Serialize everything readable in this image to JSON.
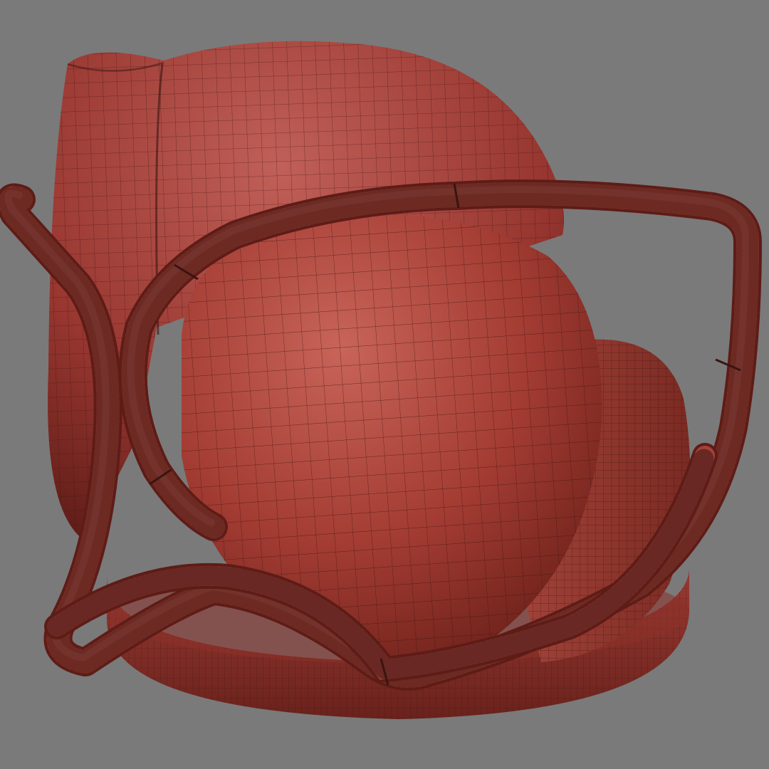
{
  "scene": {
    "subject": "chair-wireframe-render",
    "colors": {
      "background": "#7a7a7a",
      "surface_base": "#9a3a32",
      "surface_light": "#c05a4d",
      "surface_dark": "#5e1e1a",
      "wire": "#3a1410"
    }
  }
}
